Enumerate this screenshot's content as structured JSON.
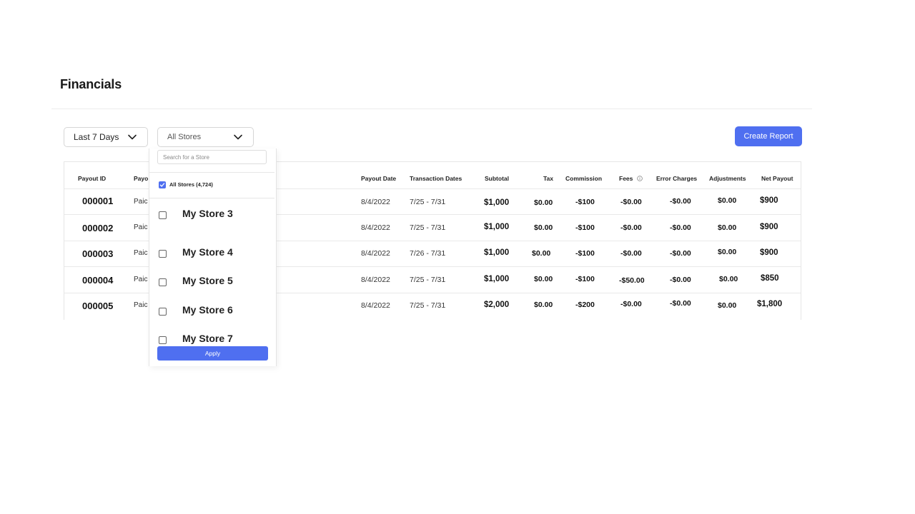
{
  "page": {
    "title": "Financials"
  },
  "filters": {
    "date_range": "Last 7 Days",
    "stores": "All Stores"
  },
  "actions": {
    "create_report": "Create Report"
  },
  "table": {
    "headers": {
      "payout_id": "Payout ID",
      "status": "Payo",
      "payout_date": "Payout Date",
      "transaction_dates": "Transaction Dates",
      "subtotal": "Subtotal",
      "tax": "Tax",
      "commission": "Commission",
      "fees": "Fees",
      "error_charges": "Error Charges",
      "adjustments": "Adjustments",
      "net_payout": "Net Payout"
    },
    "rows": [
      {
        "id": "000001",
        "status": "Paic",
        "payout_date": "8/4/2022",
        "transaction_dates": "7/25 - 7/31",
        "subtotal": "$1,000",
        "tax": "$0.00",
        "commission": "-$100",
        "fees": "-$0.00",
        "error_charges": "-$0.00",
        "adjustments": "$0.00",
        "net_payout": "$900"
      },
      {
        "id": "000002",
        "status": "Paic",
        "payout_date": "8/4/2022",
        "transaction_dates": "7/25 - 7/31",
        "subtotal": "$1,000",
        "tax": "$0.00",
        "commission": "-$100",
        "fees": "-$0.00",
        "error_charges": "-$0.00",
        "adjustments": "$0.00",
        "net_payout": "$900"
      },
      {
        "id": "000003",
        "status": "Paic",
        "payout_date": "8/4/2022",
        "transaction_dates": "7/26 - 7/31",
        "subtotal": "$1,000",
        "tax": "$0.00",
        "commission": "-$100",
        "fees": "-$0.00",
        "error_charges": "-$0.00",
        "adjustments": "$0.00",
        "net_payout": "$900"
      },
      {
        "id": "000004",
        "status": "Paic",
        "payout_date": "8/4/2022",
        "transaction_dates": "7/25 - 7/31",
        "subtotal": "$1,000",
        "tax": "$0.00",
        "commission": "-$100",
        "fees": "-$50.00",
        "error_charges": "-$0.00",
        "adjustments": "$0.00",
        "net_payout": "$850"
      },
      {
        "id": "000005",
        "status": "Paic",
        "payout_date": "8/4/2022",
        "transaction_dates": "7/25 - 7/31",
        "subtotal": "$2,000",
        "tax": "$0.00",
        "commission": "-$200",
        "fees": "-$0.00",
        "error_charges": "-$0.00",
        "adjustments": "$0.00",
        "net_payout": "$1,800"
      }
    ]
  },
  "store_dropdown": {
    "search_placeholder": "Search for a Store",
    "all_stores_label": "All Stores (4,724)",
    "stores": [
      "My Store 3",
      "My Store 4",
      "My Store 5",
      "My Store 6",
      "My Store 7"
    ],
    "apply_label": "Apply"
  },
  "colors": {
    "accent": "#4f6ff0",
    "border": "#e6e6e6",
    "text": "#111111"
  },
  "icons": {
    "dropdown": "chevron-down-icon",
    "fees_info": "info-icon",
    "checked": "checkmark-icon"
  }
}
